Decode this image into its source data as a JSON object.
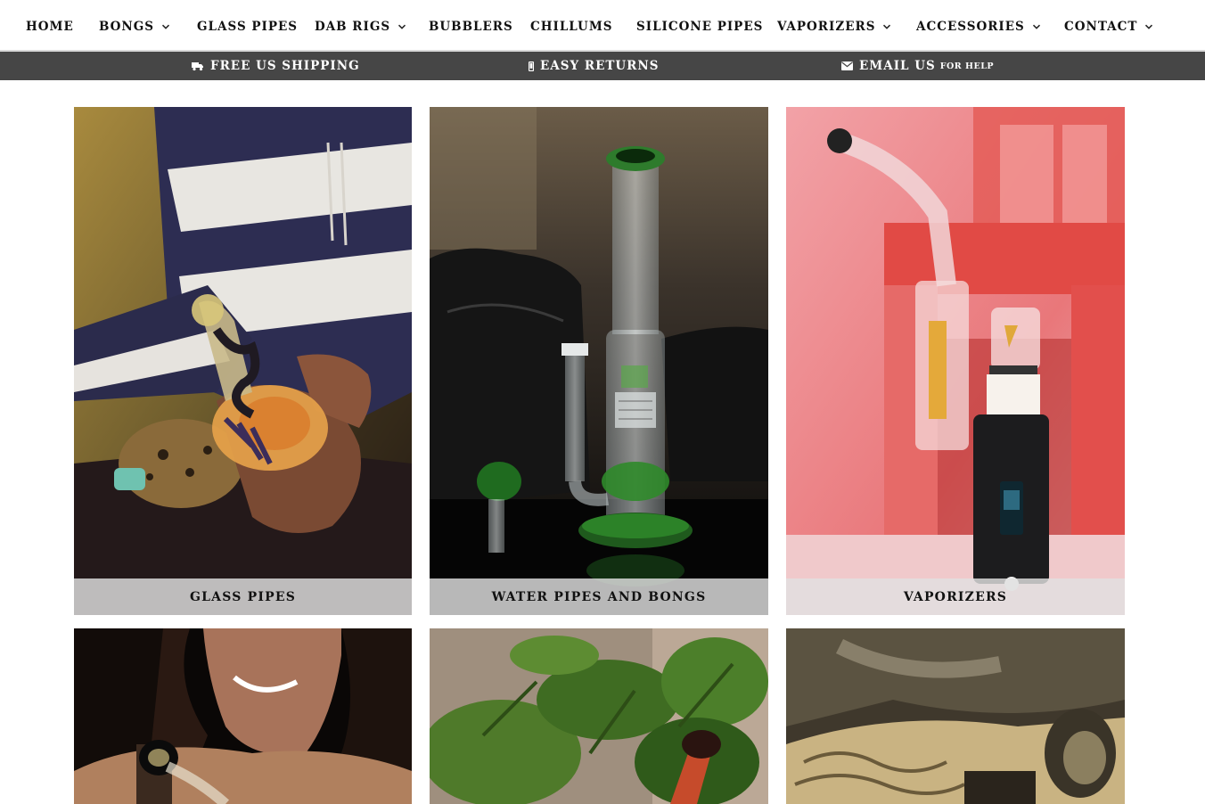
{
  "nav": {
    "items": [
      {
        "label": "HOME",
        "has_dropdown": false
      },
      {
        "label": "BONGS",
        "has_dropdown": true
      },
      {
        "label": "GLASS PIPES",
        "has_dropdown": false
      },
      {
        "label": "DAB RIGS",
        "has_dropdown": true
      },
      {
        "label": "BUBBLERS",
        "has_dropdown": false
      },
      {
        "label": "CHILLUMS",
        "has_dropdown": false
      },
      {
        "label": "SILICONE PIPES",
        "has_dropdown": false
      },
      {
        "label": "VAPORIZERS",
        "has_dropdown": true
      },
      {
        "label": "ACCESSORIES",
        "has_dropdown": true
      },
      {
        "label": "CONTACT",
        "has_dropdown": true
      }
    ],
    "dropdown_icon": "chevron-down-icon"
  },
  "infobar": {
    "shipping": {
      "label": "FREE US SHIPPING",
      "icon": "truck-icon"
    },
    "returns": {
      "label": "EASY RETURNS",
      "icon": "mobile-icon"
    },
    "email": {
      "label": "EMAIL US",
      "suffix": "FOR HELP",
      "icon": "envelope-icon"
    },
    "background": "#464646"
  },
  "tiles": [
    {
      "caption": "GLASS PIPES",
      "image": "person-holding-glass-pipe"
    },
    {
      "caption": "WATER PIPES AND BONGS",
      "image": "glass-bong-on-table"
    },
    {
      "caption": "VAPORIZERS",
      "image": "vaporizer-with-glass-attachment"
    },
    {
      "caption": "",
      "image": "woman-with-glass-pipe"
    },
    {
      "caption": "",
      "image": "pipe-among-plants"
    },
    {
      "caption": "",
      "image": "accessories-close-up"
    }
  ]
}
